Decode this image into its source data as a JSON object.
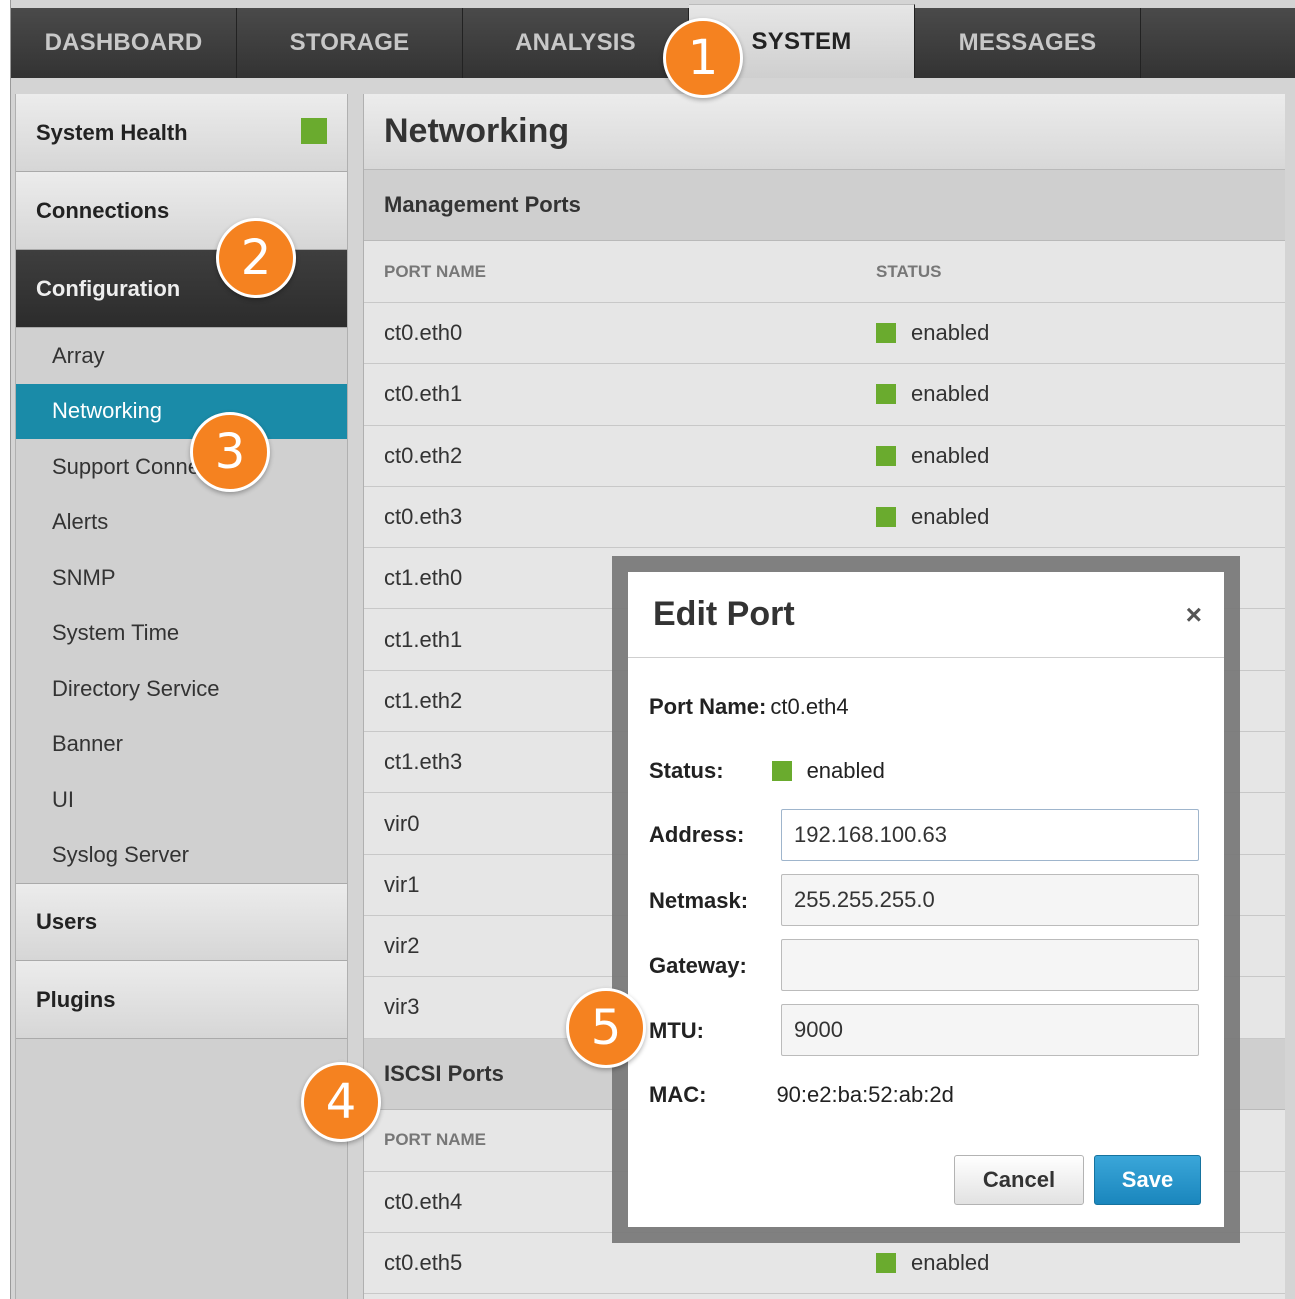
{
  "topnav": {
    "tabs": [
      {
        "label": "DASHBOARD"
      },
      {
        "label": "STORAGE"
      },
      {
        "label": "ANALYSIS"
      },
      {
        "label": "SYSTEM"
      },
      {
        "label": "MESSAGES"
      }
    ],
    "active": "SYSTEM"
  },
  "sidebar": {
    "system_health": "System Health",
    "connections": "Connections",
    "configuration": "Configuration",
    "config_items": [
      {
        "label": "Array"
      },
      {
        "label": "Networking"
      },
      {
        "label": "Support Connectivity"
      },
      {
        "label": "Alerts"
      },
      {
        "label": "SNMP"
      },
      {
        "label": "System Time"
      },
      {
        "label": "Directory Service"
      },
      {
        "label": "Banner"
      },
      {
        "label": "UI"
      },
      {
        "label": "Syslog Server"
      }
    ],
    "users": "Users",
    "plugins": "Plugins",
    "health_color": "#6aab2e",
    "active_color": "#1a8ba8"
  },
  "main": {
    "title": "Networking",
    "management": {
      "heading": "Management Ports",
      "col_port": "PORT NAME",
      "col_status": "STATUS",
      "rows": [
        {
          "port": "ct0.eth0",
          "status": "enabled"
        },
        {
          "port": "ct0.eth1",
          "status": "enabled"
        },
        {
          "port": "ct0.eth2",
          "status": "enabled"
        },
        {
          "port": "ct0.eth3",
          "status": "enabled"
        },
        {
          "port": "ct1.eth0",
          "status": ""
        },
        {
          "port": "ct1.eth1",
          "status": ""
        },
        {
          "port": "ct1.eth2",
          "status": ""
        },
        {
          "port": "ct1.eth3",
          "status": ""
        },
        {
          "port": "vir0",
          "status": ""
        },
        {
          "port": "vir1",
          "status": ""
        },
        {
          "port": "vir2",
          "status": ""
        },
        {
          "port": "vir3",
          "status": ""
        }
      ]
    },
    "iscsi": {
      "heading": "ISCSI Ports",
      "col_port": "PORT NAME",
      "rows": [
        {
          "port": "ct0.eth4",
          "status": ""
        },
        {
          "port": "ct0.eth5",
          "status": "enabled"
        }
      ]
    }
  },
  "modal": {
    "title": "Edit Port",
    "close_glyph": "×",
    "port_name_label": "Port Name:",
    "port_name_value": "ct0.eth4",
    "status_label": "Status:",
    "status_value": "enabled",
    "address_label": "Address:",
    "address_value": "192.168.100.63",
    "netmask_label": "Netmask:",
    "netmask_value": "255.255.255.0",
    "gateway_label": "Gateway:",
    "gateway_value": "",
    "mtu_label": "MTU:",
    "mtu_value": "9000",
    "mac_label": "MAC:",
    "mac_value": "90:e2:ba:52:ab:2d",
    "cancel_label": "Cancel",
    "save_label": "Save",
    "save_color": "#2196cf"
  },
  "callouts": [
    {
      "label": "1"
    },
    {
      "label": "2"
    },
    {
      "label": "3"
    },
    {
      "label": "4"
    },
    {
      "label": "5"
    }
  ],
  "callout_color": "#f58220"
}
